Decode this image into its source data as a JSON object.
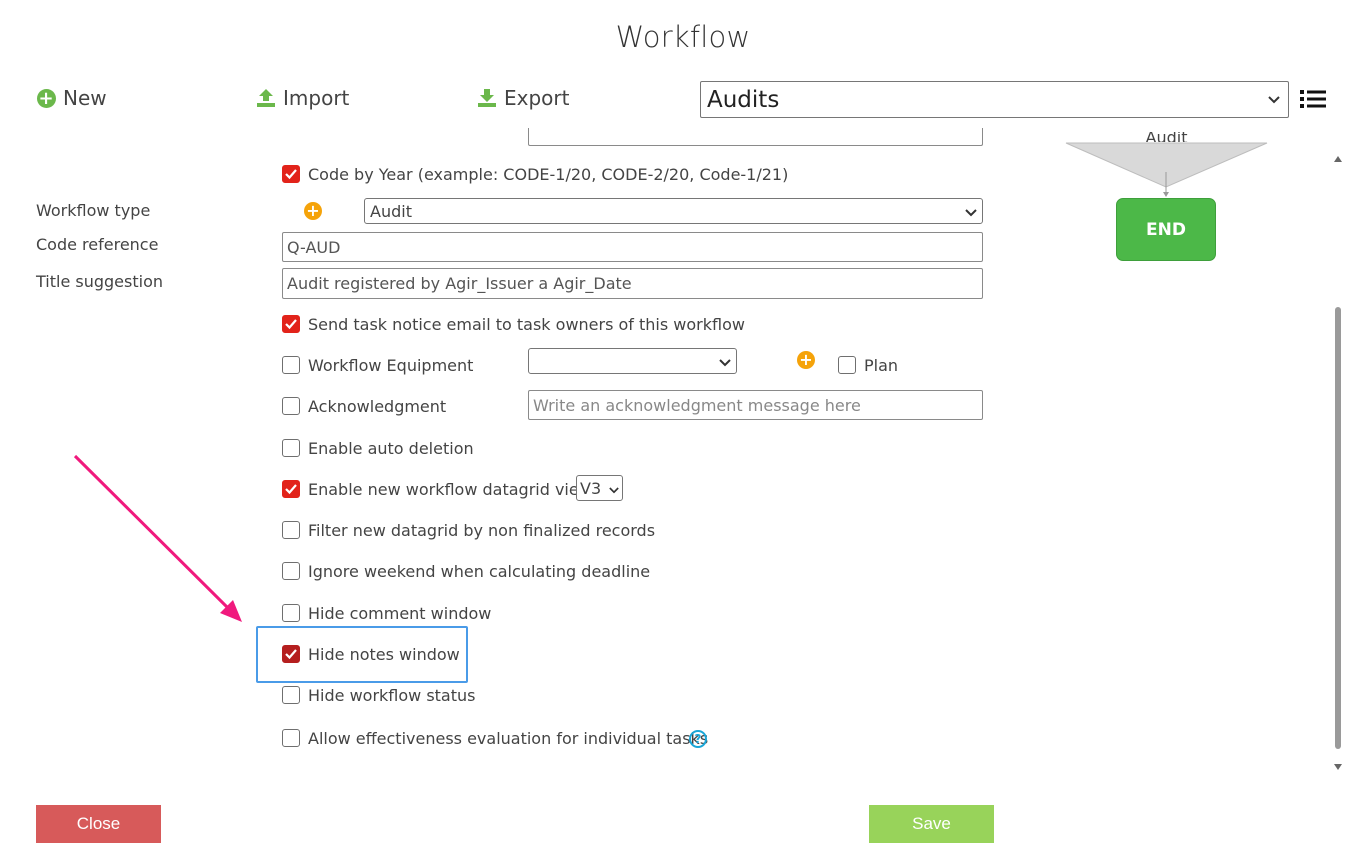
{
  "title": "Workflow",
  "toolbar": {
    "new_label": "New",
    "import_label": "Import",
    "export_label": "Export",
    "workflow_selected": "Audits"
  },
  "form": {
    "code_by_year": {
      "label": "Code by Year (example: CODE-1/20, CODE-2/20, Code-1/21)",
      "checked": true
    },
    "workflow_type": {
      "label": "Workflow type",
      "value": "Audit"
    },
    "code_reference": {
      "label": "Code reference",
      "value": "Q-AUD"
    },
    "title_suggestion": {
      "label": "Title suggestion",
      "value": "Audit registered by Agir_Issuer a Agir_Date"
    },
    "send_task_notice": {
      "label": "Send task notice email to task owners of this workflow",
      "checked": true
    },
    "workflow_equipment": {
      "label": "Workflow Equipment",
      "checked": false,
      "value": ""
    },
    "plan": {
      "label": "Plan",
      "checked": false
    },
    "acknowledgment": {
      "label": "Acknowledgment",
      "checked": false,
      "placeholder": "Write an acknowledgment message here"
    },
    "enable_auto_deletion": {
      "label": "Enable auto deletion",
      "checked": false
    },
    "enable_new_datagrid": {
      "label": "Enable new workflow datagrid view",
      "checked": true,
      "version": "V3"
    },
    "filter_datagrid": {
      "label": "Filter new datagrid by non finalized records",
      "checked": false
    },
    "ignore_weekend": {
      "label": "Ignore weekend when calculating deadline",
      "checked": false
    },
    "hide_comment": {
      "label": "Hide comment window",
      "checked": false
    },
    "hide_notes": {
      "label": "Hide notes window",
      "checked": true
    },
    "hide_status": {
      "label": "Hide workflow status",
      "checked": false
    },
    "allow_effectiveness": {
      "label": "Allow effectiveness evaluation for individual tasks",
      "checked": false
    }
  },
  "diagram": {
    "shape_label": "Audit",
    "end_label": "END"
  },
  "footer": {
    "close_label": "Close",
    "save_label": "Save"
  },
  "colors": {
    "checkbox_on": "#e2231a",
    "end_green": "#4cb848",
    "close_red": "#d75a5a",
    "save_green": "#98d35a",
    "highlight_blue": "#4a9be8",
    "arrow_pink": "#f0197d"
  }
}
